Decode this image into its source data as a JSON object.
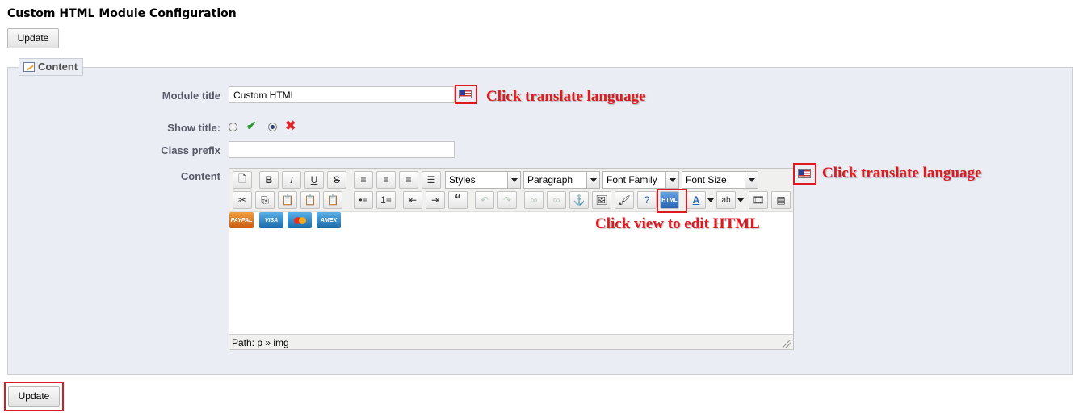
{
  "page": {
    "title": "Custom HTML Module Configuration",
    "update_label": "Update"
  },
  "content_section": {
    "legend": "Content"
  },
  "form": {
    "module_title_label": "Module title",
    "module_title_value": "Custom HTML",
    "show_title_label": "Show title:",
    "show_title_selected": "no",
    "class_prefix_label": "Class prefix",
    "class_prefix_value": "",
    "content_label": "Content"
  },
  "annotations": {
    "translate_1": "Click translate language",
    "translate_2": "Click translate language",
    "view_html": "Click view to edit HTML"
  },
  "editor": {
    "styles_label": "Styles",
    "format_label": "Paragraph",
    "font_family_label": "Font Family",
    "font_size_label": "Font Size",
    "path_text": "Path: p » img",
    "html_button_label": "HTML",
    "content_images": [
      "PAYPAL",
      "VISA",
      "MasterCard",
      "AMEX"
    ]
  },
  "colors": {
    "annotation": "#e0181f",
    "panel_bg": "#ebedf4",
    "label": "#585a69"
  }
}
